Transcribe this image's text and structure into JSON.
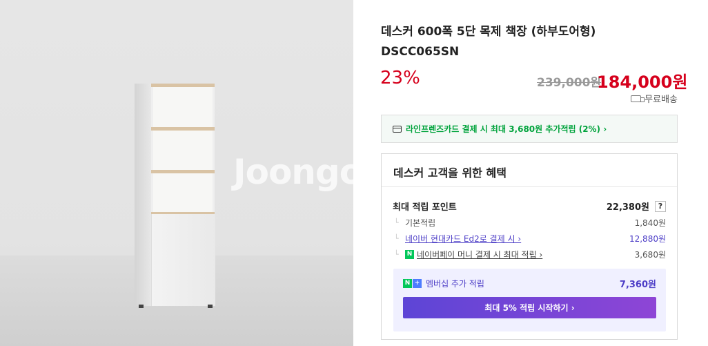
{
  "product": {
    "title": "데스커 600폭 5단 목제 책장 (하부도어형) DSCC065SN",
    "discount": "23%",
    "original_price": "239,000원",
    "sale_price": "184,000원",
    "shipping": "무료배송",
    "watermark": "Joongo"
  },
  "card_promo": {
    "text": "라인프렌즈카드 결제 시 최대 3,680원 추가적립 (2%) ›"
  },
  "benefit": {
    "heading": "데스커 고객을 위한 혜택",
    "max_points_label": "최대 적립 포인트",
    "max_points_value": "22,380원",
    "help": "?",
    "rows": [
      {
        "label": "기본적립",
        "value": "1,840원"
      },
      {
        "label": "네이버 현대카드 Ed2로 결제 시 ›",
        "value": "12,880원"
      },
      {
        "label": "네이버페이 머니 결제 시 최대 적립 ›",
        "value": "3,680원"
      }
    ],
    "tick": "└",
    "npay_badge": "N",
    "membership": {
      "badge_n": "N",
      "badge_plus": "+",
      "label": "멤버십 추가 적립",
      "value": "7,360원",
      "cta": "최대 5% 적립 시작하기 ›"
    }
  },
  "colors": {
    "sale_red": "#d6001c",
    "naver_green": "#03c75a",
    "purple": "#4d3ec7"
  }
}
